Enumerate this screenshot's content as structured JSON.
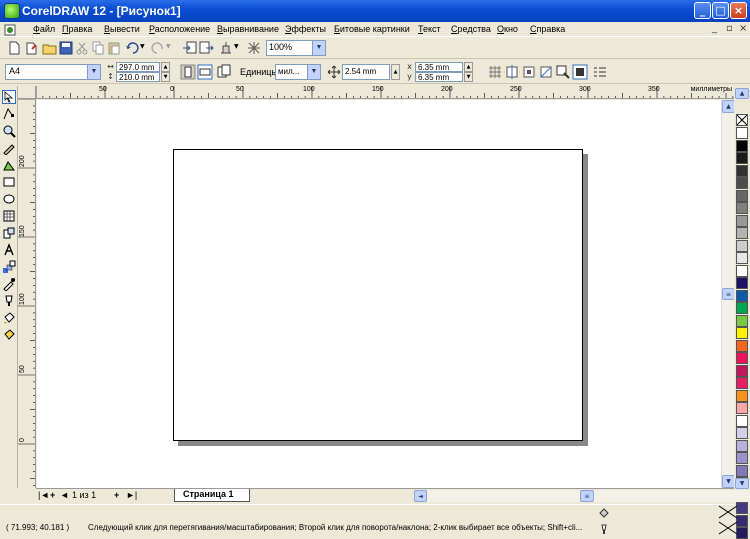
{
  "window": {
    "title": "CorelDRAW 12 - [Рисунок1]",
    "minimize_glyph": "_",
    "maximize_glyph": "□",
    "close_glyph": "×",
    "mdi_minimize_glyph": "_",
    "mdi_restore_glyph": "▫",
    "mdi_close_glyph": "×"
  },
  "menu": {
    "items": [
      "Файл",
      "Правка",
      "Вывести",
      "Расположение",
      "Выравнивание",
      "Эффекты",
      "Битовые картинки",
      "Текст",
      "Средства",
      "Окно",
      "Справка"
    ]
  },
  "toolbar": {
    "zoom_value": "100%",
    "dropdown_glyph": "▼"
  },
  "property_bar": {
    "paper_size": "A4",
    "width": "297.0 mm",
    "height": "210.0 mm",
    "units_label": "Единицы:",
    "units_value": "мил...",
    "nudge_value": "2.54 mm",
    "dup_x": "6.35 mm",
    "dup_y": "6.35 mm",
    "dup_x_label": "x",
    "dup_y_label": "y"
  },
  "rulers": {
    "horizontal_labels": [
      "50",
      "0",
      "50",
      "100",
      "150",
      "200",
      "250",
      "300",
      "350"
    ],
    "horizontal_units": "миллиметры",
    "vertical_labels": [
      "200",
      "150",
      "100",
      "50",
      "0"
    ]
  },
  "navigator": {
    "page_count": "1 из 1",
    "page_tab": "Страница 1",
    "first_glyph": "|◄",
    "prev_glyph": "◄",
    "add_glyph": "+",
    "next_glyph": "►|"
  },
  "status": {
    "coords": "( 71.993; 40.181 )",
    "hint": "Следующий клик для перетягивания/масштабирования; Второй клик для поворота/наклона; 2-клик выбирает все объекты; Shift+cli..."
  },
  "colors": {
    "title_bar": "#0a4fd4",
    "palette": [
      "#ffffff",
      "#000000",
      "#1a1a1a",
      "#333333",
      "#4d4d4d",
      "#666666",
      "#808080",
      "#999999",
      "#b3b3b3",
      "#cccccc",
      "#e6e6e6",
      "#ffffff",
      "#1b1464",
      "#0b5ca8",
      "#00a651",
      "#7ac943",
      "#fff200",
      "#f26522",
      "#ed145b",
      "#c2185b",
      "#e91e63",
      "#f7941d",
      "#f9a8a8",
      "#ffffff",
      "#d5d0ea",
      "#b6b0da",
      "#9a92ca",
      "#8178b8",
      "#6a60a6",
      "#564c94",
      "#443a82",
      "#332a70",
      "#231b5e"
    ]
  },
  "icons": {
    "toolbox": [
      "pick-icon",
      "shape-icon",
      "zoom-icon",
      "freehand-icon",
      "smart-fill-icon",
      "rectangle-icon",
      "ellipse-icon",
      "polygon-icon",
      "basic-shapes-icon",
      "text-icon",
      "interactive-blend-icon",
      "eyedropper-icon",
      "outline-icon",
      "fill-icon",
      "interactive-fill-icon"
    ]
  }
}
